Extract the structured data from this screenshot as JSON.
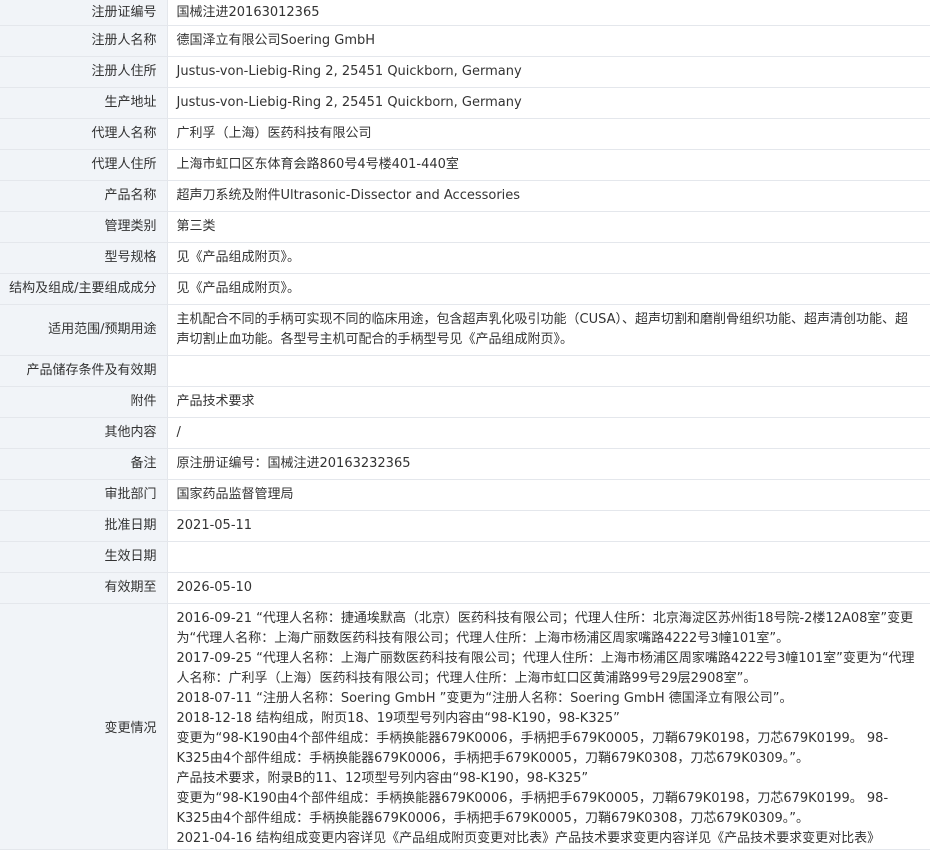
{
  "rows": [
    {
      "label": "注册证编号",
      "value": "国械注进20163012365"
    },
    {
      "label": "注册人名称",
      "value": "德国泽立有限公司Soering GmbH"
    },
    {
      "label": "注册人住所",
      "value": "Justus-von-Liebig-Ring 2, 25451 Quickborn, Germany"
    },
    {
      "label": "生产地址",
      "value": "Justus-von-Liebig-Ring 2, 25451 Quickborn, Germany"
    },
    {
      "label": "代理人名称",
      "value": "广利孚（上海）医药科技有限公司"
    },
    {
      "label": "代理人住所",
      "value": "上海市虹口区东体育会路860号4号楼401-440室"
    },
    {
      "label": "产品名称",
      "value": "超声刀系统及附件Ultrasonic-Dissector and Accessories"
    },
    {
      "label": "管理类别",
      "value": "第三类"
    },
    {
      "label": "型号规格",
      "value": "见《产品组成附页》。"
    },
    {
      "label": "结构及组成/主要组成成分",
      "value": "见《产品组成附页》。"
    },
    {
      "label": "适用范围/预期用途",
      "value": "主机配合不同的手柄可实现不同的临床用途，包含超声乳化吸引功能（CUSA）、超声切割和磨削骨组织功能、超声清创功能、超声切割止血功能。各型号主机可配合的手柄型号见《产品组成附页》。"
    },
    {
      "label": "产品储存条件及有效期",
      "value": ""
    },
    {
      "label": "附件",
      "value": "产品技术要求"
    },
    {
      "label": "其他内容",
      "value": "/"
    },
    {
      "label": "备注",
      "value": "原注册证编号：国械注进20163232365"
    },
    {
      "label": "审批部门",
      "value": "国家药品监督管理局"
    },
    {
      "label": "批准日期",
      "value": "2021-05-11"
    },
    {
      "label": "生效日期",
      "value": ""
    },
    {
      "label": "有效期至",
      "value": "2026-05-10"
    }
  ],
  "change": {
    "label": "变更情况",
    "lines": [
      "2016-09-21 “代理人名称：捷通埃默高（北京）医药科技有限公司；代理人住所：北京海淀区苏州街18号院-2楼12A08室”变更为“代理人名称：上海广丽数医药科技有限公司；代理人住所：上海市杨浦区周家嘴路4222号3幢101室”。",
      "2017-09-25 “代理人名称：上海广丽数医药科技有限公司；代理人住所：上海市杨浦区周家嘴路4222号3幢101室”变更为“代理人名称：广利孚（上海）医药科技有限公司；代理人住所：上海市虹口区黄浦路99号29层2908室”。",
      "2018-07-11 “注册人名称：Soering GmbH ”变更为“注册人名称：Soering GmbH 德国泽立有限公司”。",
      "2018-12-18 结构组成，附页18、19项型号列内容由“98-K190，98-K325”",
      "变更为“98-K190由4个部件组成：手柄换能器679K0006，手柄把手679K0005，刀鞘679K0198，刀芯679K0199。 98-K325由4个部件组成：手柄换能器679K0006，手柄把手679K0005，刀鞘679K0308，刀芯679K0309。”。",
      "产品技术要求，附录B的11、12项型号列内容由“98-K190，98-K325”",
      "变更为“98-K190由4个部件组成：手柄换能器679K0006，手柄把手679K0005，刀鞘679K0198，刀芯679K0199。 98-K325由4个部件组成：手柄换能器679K0006，手柄把手679K0005，刀鞘679K0308，刀芯679K0309。”。",
      "2021-04-16 结构组成变更内容详见《产品组成附页变更对比表》产品技术要求变更内容详见《产品技术要求变更对比表》"
    ]
  }
}
